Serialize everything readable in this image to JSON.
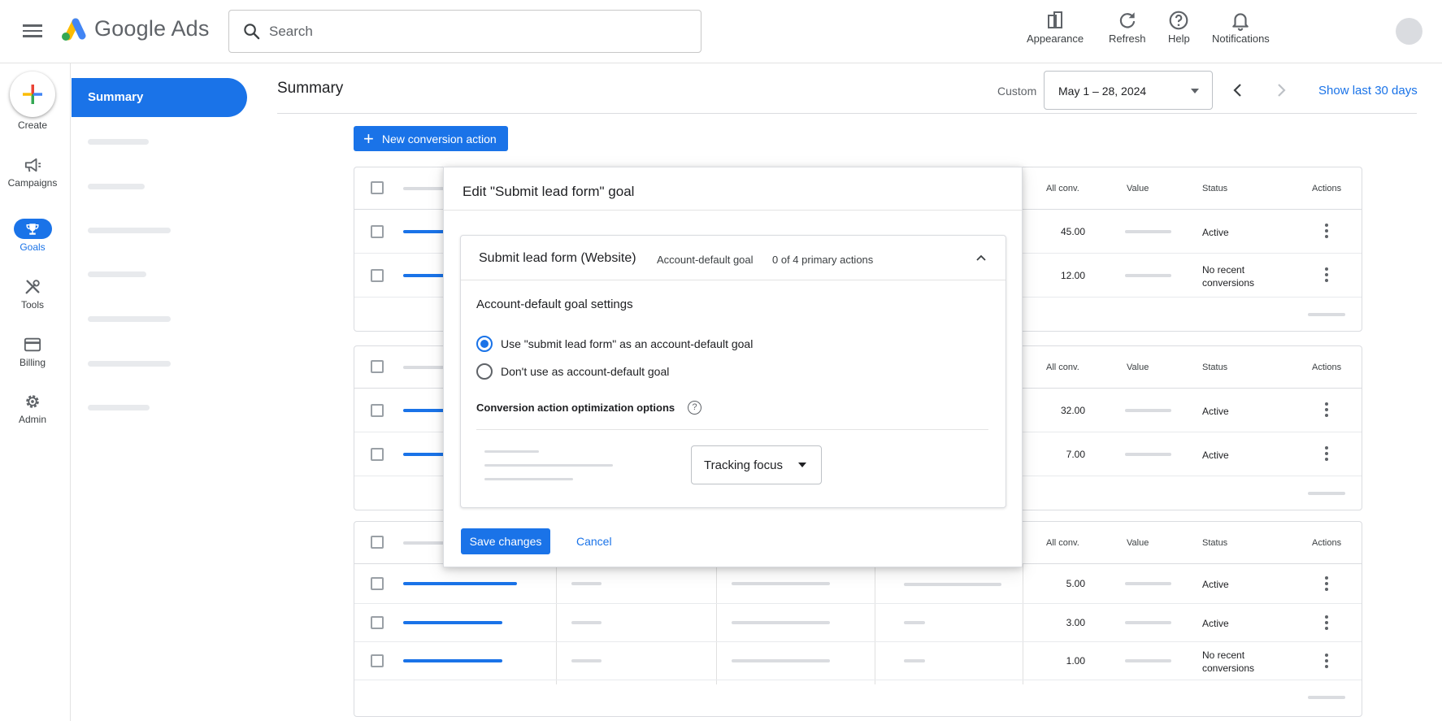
{
  "app": {
    "name": "Google Ads"
  },
  "search": {
    "placeholder": "Search",
    "value": ""
  },
  "toolbar": [
    {
      "label": "Appearance",
      "icon": "appearance-icon"
    },
    {
      "label": "Refresh",
      "icon": "refresh-icon"
    },
    {
      "label": "Help",
      "icon": "help-icon"
    },
    {
      "label": "Notifications",
      "icon": "notifications-icon"
    }
  ],
  "rail": {
    "create_label": "Create",
    "items": [
      {
        "label": "Campaigns",
        "icon": "campaigns-icon",
        "active": false
      },
      {
        "label": "Goals",
        "icon": "goals-icon",
        "active": true
      },
      {
        "label": "Tools",
        "icon": "tools-icon",
        "active": false
      },
      {
        "label": "Billing",
        "icon": "billing-icon",
        "active": false
      },
      {
        "label": "Admin",
        "icon": "admin-icon",
        "active": false
      }
    ]
  },
  "nav": {
    "active_label": "Summary"
  },
  "page": {
    "title": "Summary",
    "date_mode": "Custom",
    "date_range": "May 1 – 28, 2024",
    "show_last_label": "Show last 30 days",
    "new_action_label": "New conversion action"
  },
  "tables": {
    "headers": {
      "all_conv": "All conv.",
      "value": "Value",
      "status": "Status",
      "actions": "Actions"
    },
    "groups": [
      {
        "rows": [
          {
            "all_conv": "45.00",
            "status": "Active"
          },
          {
            "all_conv": "12.00",
            "status": "No recent conversions"
          }
        ]
      },
      {
        "rows": [
          {
            "all_conv": "32.00",
            "status": "Active"
          },
          {
            "all_conv": "7.00",
            "status": "Active"
          }
        ]
      },
      {
        "rows": [
          {
            "all_conv": "5.00",
            "status": "Active"
          },
          {
            "all_conv": "3.00",
            "status": "Active"
          },
          {
            "all_conv": "1.00",
            "status": "No recent conversions"
          }
        ]
      }
    ]
  },
  "dialog": {
    "title": "Edit \"Submit lead form\" goal",
    "goal_name": "Submit lead form (Website)",
    "goal_type": "Account-default goal",
    "primary_actions": "0 of 4 primary actions",
    "settings_title": "Account-default goal settings",
    "options": [
      {
        "label": "Use \"submit lead form\" as an account-default goal",
        "selected": true
      },
      {
        "label": "Don't use as account-default goal",
        "selected": false
      }
    ],
    "optimization_title": "Conversion action optimization options",
    "help_glyph": "?",
    "tracking_select": "Tracking focus",
    "save_label": "Save changes",
    "cancel_label": "Cancel"
  },
  "colors": {
    "primary": "#1a73e8",
    "text": "#202124",
    "muted": "#5f6368",
    "border": "#dadce0"
  }
}
